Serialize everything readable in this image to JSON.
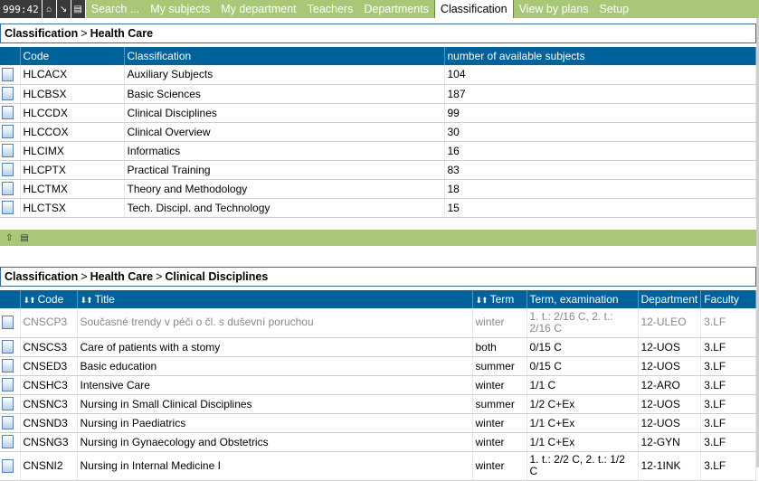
{
  "nav": {
    "timer": "999:42",
    "items": [
      "Search ...",
      "My subjects",
      "My department",
      "Teachers",
      "Departments",
      "Classification",
      "View by plans",
      "Setup"
    ],
    "active": "Classification"
  },
  "top": {
    "breadcrumb": [
      "Classification",
      "Health Care"
    ],
    "headers": [
      "Code",
      "Classification",
      "number of available subjects"
    ],
    "rows": [
      {
        "code": "HLCACX",
        "name": "Auxiliary Subjects",
        "count": "104"
      },
      {
        "code": "HLCBSX",
        "name": "Basic Sciences",
        "count": "187"
      },
      {
        "code": "HLCCDX",
        "name": "Clinical Disciplines",
        "count": "99"
      },
      {
        "code": "HLCCOX",
        "name": "Clinical Overview",
        "count": "30"
      },
      {
        "code": "HLCIMX",
        "name": "Informatics",
        "count": "16"
      },
      {
        "code": "HLCPTX",
        "name": "Practical Training",
        "count": "83"
      },
      {
        "code": "HLCTMX",
        "name": "Theory and Methodology",
        "count": "18"
      },
      {
        "code": "HLCTSX",
        "name": "Tech. Discipl. and Technology",
        "count": "15"
      }
    ]
  },
  "bottom": {
    "breadcrumb": [
      "Classification",
      "Health Care",
      "Clinical Disciplines"
    ],
    "headers": {
      "code": "Code",
      "title": "Title",
      "term": "Term",
      "exam": "Term, examination",
      "dept": "Department",
      "faculty": "Faculty"
    },
    "sort_arrows": "⬇⬆",
    "rows": [
      {
        "code": "CNSCP3",
        "title": "Současné trendy v péči o čl. s duševní poruchou",
        "term": "winter",
        "exam": "1. t.: 2/16 C, 2. t.: 2/16 C",
        "dept": "12-ULEO",
        "faculty": "3.LF",
        "muted": true
      },
      {
        "code": "CNSCS3",
        "title": "Care of patients with a stomy",
        "term": "both",
        "exam": "0/15 C",
        "dept": "12-UOS",
        "faculty": "3.LF"
      },
      {
        "code": "CNSED3",
        "title": "Basic education",
        "term": "summer",
        "exam": "0/15 C",
        "dept": "12-UOS",
        "faculty": "3.LF"
      },
      {
        "code": "CNSHC3",
        "title": "Intensive Care",
        "term": "winter",
        "exam": "1/1 C",
        "dept": "12-ARO",
        "faculty": "3.LF"
      },
      {
        "code": "CNSNC3",
        "title": "Nursing in Small Clinical Disciplines",
        "term": "summer",
        "exam": "1/2 C+Ex",
        "dept": "12-UOS",
        "faculty": "3.LF"
      },
      {
        "code": "CNSND3",
        "title": "Nursing in Paediatrics",
        "term": "winter",
        "exam": "1/1 C+Ex",
        "dept": "12-UOS",
        "faculty": "3.LF"
      },
      {
        "code": "CNSNG3",
        "title": "Nursing in Gynaecology and Obstetrics",
        "term": "winter",
        "exam": "1/1 C+Ex",
        "dept": "12-GYN",
        "faculty": "3.LF"
      },
      {
        "code": "CNSNI2",
        "title": "Nursing in Internal Medicine I",
        "term": "winter",
        "exam": "1. t.: 2/2 C, 2. t.: 1/2 C",
        "dept": "12-1INK",
        "faculty": "3.LF"
      }
    ]
  }
}
